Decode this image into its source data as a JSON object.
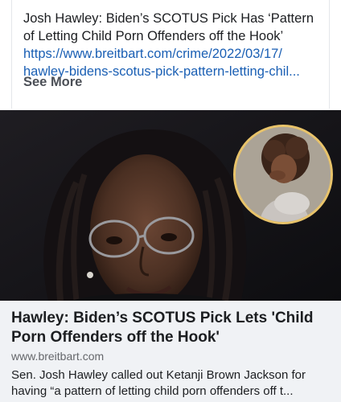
{
  "post": {
    "text_lines": [
      "Josh Hawley: Biden’s SCOTUS Pick Has ‘Pattern",
      "of Letting Child Porn Offenders off the Hook’"
    ],
    "link_lines": [
      "https://www.breitbart.com/crime/2022/03/17/",
      "hawley-bidens-scotus-pick-pattern-letting-chil..."
    ],
    "see_more": "See More"
  },
  "preview": {
    "headline_lines": [
      "Hawley: Biden’s SCOTUS Pick Lets 'Child",
      "Porn Offenders off the Hook'"
    ],
    "domain": "www.breitbart.com",
    "description_lines": [
      "Sen. Josh Hawley called out Ketanji Brown Jackson for",
      "having “a pattern of letting child porn offenders off t..."
    ]
  },
  "colors": {
    "link": "#1a5fb4",
    "inset_border": "#e8c36a",
    "preview_bg": "#f0f2f5"
  }
}
